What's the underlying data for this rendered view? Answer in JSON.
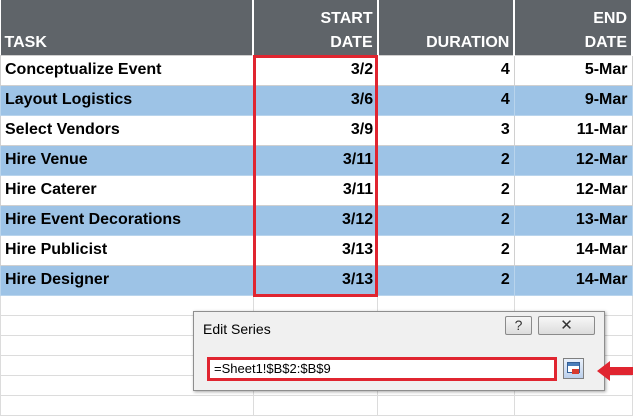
{
  "headers": {
    "task": "TASK",
    "start_line1": "START",
    "start_line2": "DATE",
    "duration": "DURATION",
    "end_line1": "END",
    "end_line2": "DATE"
  },
  "rows": [
    {
      "task": "Conceptualize Event",
      "start": "3/2",
      "duration": "4",
      "end": "5-Mar"
    },
    {
      "task": "Layout Logistics",
      "start": "3/6",
      "duration": "4",
      "end": "9-Mar"
    },
    {
      "task": "Select Vendors",
      "start": "3/9",
      "duration": "3",
      "end": "11-Mar"
    },
    {
      "task": "Hire Venue",
      "start": "3/11",
      "duration": "2",
      "end": "12-Mar"
    },
    {
      "task": "Hire Caterer",
      "start": "3/11",
      "duration": "2",
      "end": "12-Mar"
    },
    {
      "task": "Hire Event Decorations",
      "start": "3/12",
      "duration": "2",
      "end": "13-Mar"
    },
    {
      "task": "Hire Publicist",
      "start": "3/13",
      "duration": "2",
      "end": "14-Mar"
    },
    {
      "task": "Hire Designer",
      "start": "3/13",
      "duration": "2",
      "end": "14-Mar"
    }
  ],
  "dialog": {
    "title": "Edit Series",
    "help_label": "?",
    "close_label": "✕",
    "range_value": "=Sheet1!$B$2:$B$9"
  },
  "colors": {
    "header_bg": "#5f6469",
    "alt_row_bg": "#9dc3e6",
    "highlight_red": "#e02530"
  }
}
